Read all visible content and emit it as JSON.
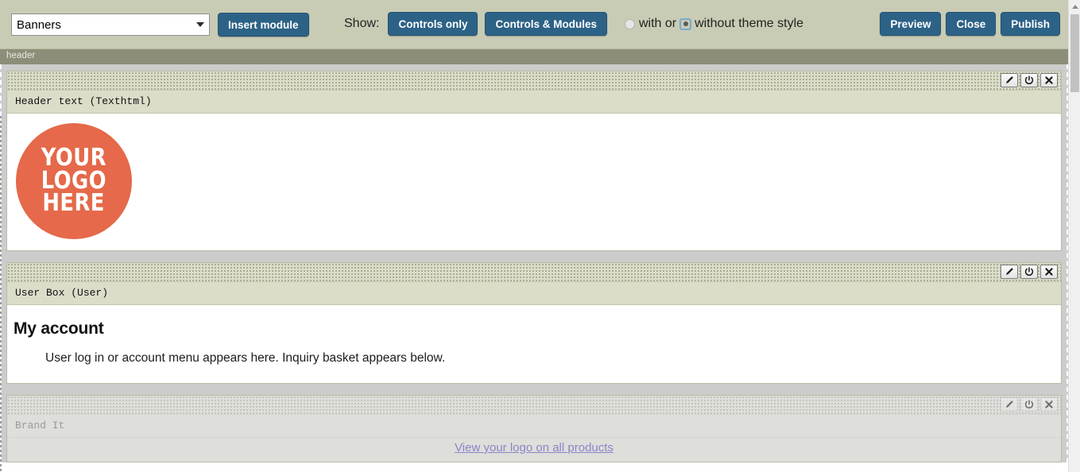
{
  "toolbar": {
    "module_select": {
      "value": "Banners",
      "options": [
        "Banners"
      ],
      "arrow_icon": "chevron-down-icon"
    },
    "insert_module_label": "Insert module",
    "show_label": "Show:",
    "controls_only_label": "Controls only",
    "controls_and_modules_label": "Controls & Modules",
    "radio_with_label": "with or",
    "radio_without_label": "without theme style",
    "radio_with_checked": false,
    "radio_without_checked": true,
    "preview_label": "Preview",
    "close_label": "Close",
    "publish_label": "Publish",
    "accent_color": "#2d6287",
    "bar_color": "#c9ccb4"
  },
  "zone": {
    "label": "header"
  },
  "modules": [
    {
      "title": "Header text (Texthtml)",
      "enabled": true,
      "controls": [
        {
          "icon": "pencil-icon",
          "name": "edit-module-button"
        },
        {
          "icon": "power-icon",
          "name": "toggle-module-button"
        },
        {
          "icon": "close-x-icon",
          "name": "remove-module-button"
        }
      ],
      "content_type": "logo",
      "logo": {
        "lines": [
          "YOUR",
          "LOGO",
          "HERE"
        ],
        "color": "#e5694a"
      }
    },
    {
      "title": "User Box (User)",
      "enabled": true,
      "controls": [
        {
          "icon": "pencil-icon",
          "name": "edit-module-button"
        },
        {
          "icon": "power-icon",
          "name": "toggle-module-button"
        },
        {
          "icon": "close-x-icon",
          "name": "remove-module-button"
        }
      ],
      "content_type": "account",
      "account": {
        "heading": "My account",
        "body": "User log in or account menu appears here. Inquiry basket appears below."
      }
    },
    {
      "title": "Brand It",
      "enabled": false,
      "controls": [
        {
          "icon": "pencil-icon",
          "name": "edit-module-button"
        },
        {
          "icon": "power-icon",
          "name": "toggle-module-button"
        },
        {
          "icon": "close-x-icon",
          "name": "remove-module-button"
        }
      ],
      "content_type": "brand",
      "brand": {
        "link_text": "View your logo on all products",
        "link_color": "#8a86c8"
      }
    }
  ],
  "scrollbar": {
    "up_arrow_icon": "triangle-up-icon"
  }
}
